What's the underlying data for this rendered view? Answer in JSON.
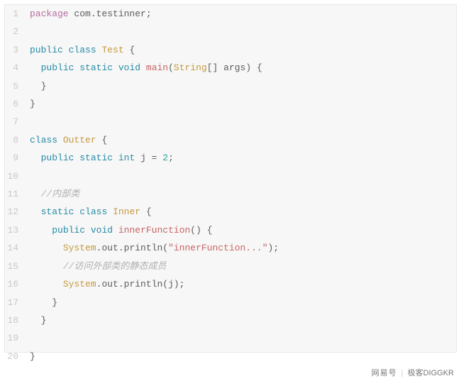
{
  "code": {
    "lines": [
      {
        "n": 1,
        "tokens": [
          [
            "kw",
            "package"
          ],
          [
            "pkg",
            " com.testinner;"
          ]
        ]
      },
      {
        "n": 2,
        "tokens": []
      },
      {
        "n": 3,
        "tokens": [
          [
            "kw2",
            "public"
          ],
          [
            "",
            " "
          ],
          [
            "kw2",
            "class"
          ],
          [
            "",
            " "
          ],
          [
            "cls",
            "Test"
          ],
          [
            "punc",
            " {"
          ]
        ]
      },
      {
        "n": 4,
        "tokens": [
          [
            "",
            "  "
          ],
          [
            "kw2",
            "public"
          ],
          [
            "",
            " "
          ],
          [
            "kw2",
            "static"
          ],
          [
            "",
            " "
          ],
          [
            "kw2",
            "void"
          ],
          [
            "",
            " "
          ],
          [
            "fn",
            "main"
          ],
          [
            "punc",
            "("
          ],
          [
            "cls",
            "String"
          ],
          [
            "punc",
            "[] args) {"
          ]
        ]
      },
      {
        "n": 5,
        "tokens": [
          [
            "punc",
            "  }"
          ]
        ]
      },
      {
        "n": 6,
        "tokens": [
          [
            "punc",
            "}"
          ]
        ]
      },
      {
        "n": 7,
        "tokens": []
      },
      {
        "n": 8,
        "tokens": [
          [
            "kw2",
            "class"
          ],
          [
            "",
            " "
          ],
          [
            "cls",
            "Outter"
          ],
          [
            "punc",
            " {"
          ]
        ]
      },
      {
        "n": 9,
        "tokens": [
          [
            "",
            "  "
          ],
          [
            "kw2",
            "public"
          ],
          [
            "",
            " "
          ],
          [
            "kw2",
            "static"
          ],
          [
            "",
            " "
          ],
          [
            "kw2",
            "int"
          ],
          [
            "",
            " j = "
          ],
          [
            "num",
            "2"
          ],
          [
            "punc",
            ";"
          ]
        ]
      },
      {
        "n": 10,
        "tokens": []
      },
      {
        "n": 11,
        "tokens": [
          [
            "",
            "  "
          ],
          [
            "cmt",
            "//内部类"
          ]
        ]
      },
      {
        "n": 12,
        "tokens": [
          [
            "",
            "  "
          ],
          [
            "kw2",
            "static"
          ],
          [
            "",
            " "
          ],
          [
            "kw2",
            "class"
          ],
          [
            "",
            " "
          ],
          [
            "cls",
            "Inner"
          ],
          [
            "punc",
            " {"
          ]
        ]
      },
      {
        "n": 13,
        "tokens": [
          [
            "",
            "    "
          ],
          [
            "kw2",
            "public"
          ],
          [
            "",
            " "
          ],
          [
            "kw2",
            "void"
          ],
          [
            "",
            " "
          ],
          [
            "fn",
            "innerFunction"
          ],
          [
            "punc",
            "() {"
          ]
        ]
      },
      {
        "n": 14,
        "tokens": [
          [
            "",
            "      "
          ],
          [
            "cls",
            "System"
          ],
          [
            "dot",
            "."
          ],
          [
            "",
            "out"
          ],
          [
            "dot",
            "."
          ],
          [
            "",
            "println("
          ],
          [
            "str",
            "\"innerFunction...\""
          ],
          [
            "punc",
            ");"
          ]
        ]
      },
      {
        "n": 15,
        "tokens": [
          [
            "",
            "      "
          ],
          [
            "cmt",
            "//访问外部类的静态成员"
          ]
        ]
      },
      {
        "n": 16,
        "tokens": [
          [
            "",
            "      "
          ],
          [
            "cls",
            "System"
          ],
          [
            "dot",
            "."
          ],
          [
            "",
            "out"
          ],
          [
            "dot",
            "."
          ],
          [
            "",
            "println(j);"
          ]
        ]
      },
      {
        "n": 17,
        "tokens": [
          [
            "punc",
            "    }"
          ]
        ]
      },
      {
        "n": 18,
        "tokens": [
          [
            "punc",
            "  }"
          ]
        ]
      },
      {
        "n": 19,
        "tokens": []
      },
      {
        "n": 20,
        "tokens": [
          [
            "punc",
            "}"
          ]
        ]
      }
    ]
  },
  "footer": {
    "brand": "网易号",
    "author": "极客DIGGKR"
  }
}
